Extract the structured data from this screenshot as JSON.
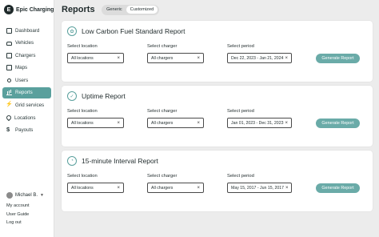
{
  "brand": {
    "name": "Epic Charging",
    "logo_text": "E"
  },
  "sidebar": {
    "items": [
      {
        "label": "Dashboard",
        "icon": "dashboard-icon",
        "active": false
      },
      {
        "label": "Vehicles",
        "icon": "car-icon",
        "active": false
      },
      {
        "label": "Chargers",
        "icon": "charger-icon",
        "active": false
      },
      {
        "label": "Maps",
        "icon": "map-pin-icon",
        "active": false
      },
      {
        "label": "Users",
        "icon": "user-icon",
        "active": false
      },
      {
        "label": "Reports",
        "icon": "bar-chart-icon",
        "active": true
      },
      {
        "label": "Grid services",
        "icon": "bolt-icon",
        "active": false
      },
      {
        "label": "Locations",
        "icon": "location-icon",
        "active": false
      },
      {
        "label": "Payouts",
        "icon": "dollar-icon",
        "active": false
      }
    ],
    "user_name": "Michael B.",
    "links": [
      "My account",
      "User Guide",
      "Log out"
    ]
  },
  "header": {
    "title": "Reports",
    "toggle": [
      "Generic",
      "Customized"
    ],
    "toggle_selected": "Customized"
  },
  "reports": [
    {
      "title": "Low Carbon Fuel Standard Report",
      "location_label": "Select location",
      "location_value": "All locations",
      "charger_label": "Select charger",
      "charger_value": "All chargers",
      "period_label": "Select period",
      "period_value": "Dec 22, 2023 - Jan 21, 2024",
      "button": "Generate Report"
    },
    {
      "title": "Uptime Report",
      "location_label": "Select location",
      "location_value": "All locations",
      "charger_label": "Select charger",
      "charger_value": "All chargers",
      "period_label": "Select period",
      "period_value": "Jan 01, 2023 - Dec 31, 2023",
      "button": "Generate Report"
    },
    {
      "title": "15-minute Interval Report",
      "location_label": "Select location",
      "location_value": "All locations",
      "charger_label": "Select charger",
      "charger_value": "All chargers",
      "period_label": "Select period",
      "period_value": "May 15, 2017 - Jun 15, 2017",
      "button": "Generate Report"
    }
  ],
  "colors": {
    "accent": "#5aa09d",
    "button": "#6aaba8",
    "background": "#ececec"
  }
}
